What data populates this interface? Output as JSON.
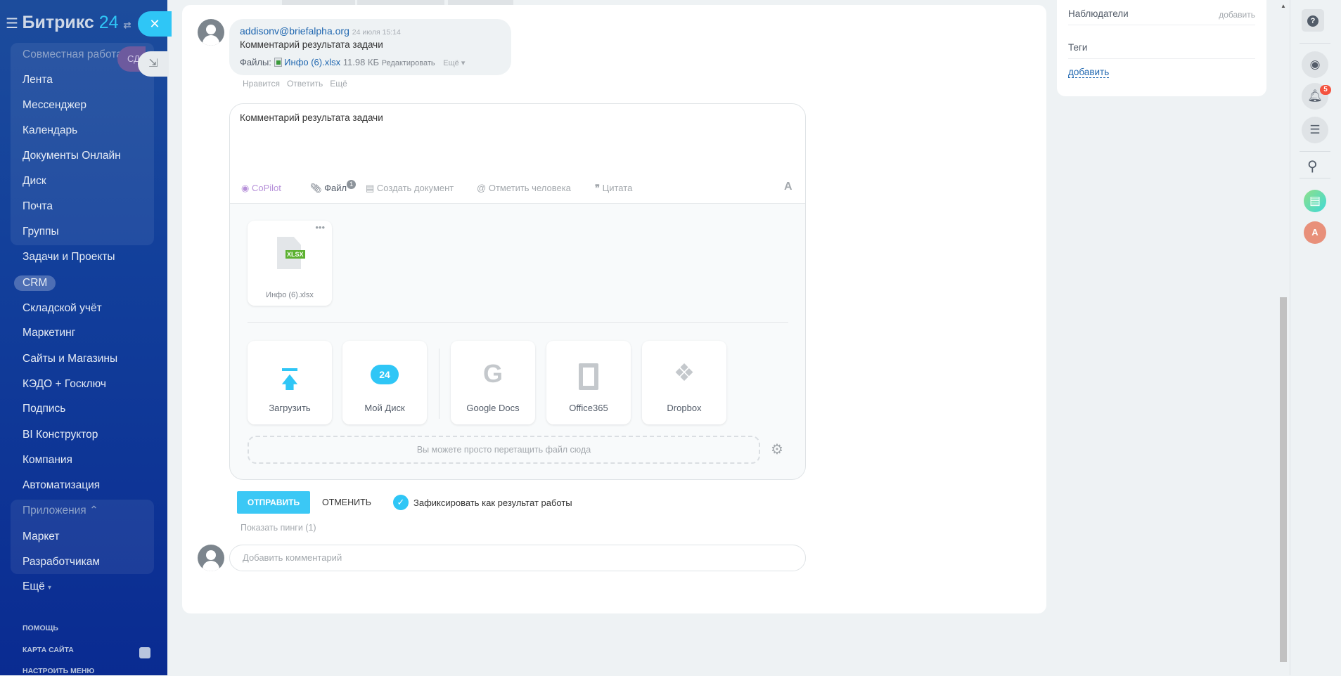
{
  "sidebar": {
    "logo": {
      "name": "Битрикс",
      "num": "24"
    },
    "items": [
      "Совместная работа",
      "Лента",
      "Мессенджер",
      "Календарь",
      "Документы Онлайн",
      "Диск",
      "Почта",
      "Группы",
      "Задачи и Проекты",
      "CRM",
      "Складской учёт",
      "Маркетинг",
      "Сайты и Магазины",
      "КЭДО + Госключ",
      "Подпись",
      "BI Конструктор",
      "Компания",
      "Автоматизация",
      "Приложения",
      "Маркет",
      "Разработчикам",
      "Ещё"
    ],
    "footer": [
      "ПОМОЩЬ",
      "КАРТА САЙТА",
      "НАСТРОИТЬ МЕНЮ"
    ],
    "purple_label": "СД"
  },
  "comment": {
    "author": "addisonv@briefalpha.org",
    "date": "24 июля 15:14",
    "text": "Комментарий результата задачи",
    "files_label": "Файлы:",
    "file_name": "Инфо (6).xlsx",
    "file_size": "11.98 КБ",
    "edit": "Редактировать",
    "more": "Ещё",
    "actions": [
      "Нравится",
      "Ответить",
      "Ещё"
    ]
  },
  "editor": {
    "text": "Комментарий результата задачи",
    "toolbar": {
      "copilot": "CoPilot",
      "file": "Файл",
      "file_count": "1",
      "create_doc": "Создать документ",
      "mention": "Отметить человека",
      "quote": "Цитата",
      "format": "A"
    },
    "attached": {
      "name": "Инфо (6).xlsx",
      "ext": "XLSX"
    },
    "sources": [
      "Загрузить",
      "Мой Диск",
      "Google Docs",
      "Office365",
      "Dropbox"
    ],
    "disk_badge": "24",
    "dropzone": "Вы можете просто перетащить файл сюда"
  },
  "actions": {
    "send": "ОТПРАВИТЬ",
    "cancel": "ОТМЕНИТЬ",
    "result_checkbox": "Зафиксировать как результат работы",
    "result_checked": true,
    "pings": "Показать пинги (1)"
  },
  "add_comment": {
    "placeholder": "Добавить комментарий"
  },
  "right_panel": {
    "observers": "Наблюдатели",
    "observers_add": "добавить",
    "tags": "Теги",
    "tags_add": "добавить"
  },
  "right_toolbar": {
    "notifications_count": "5",
    "avatar_letter": "A"
  }
}
